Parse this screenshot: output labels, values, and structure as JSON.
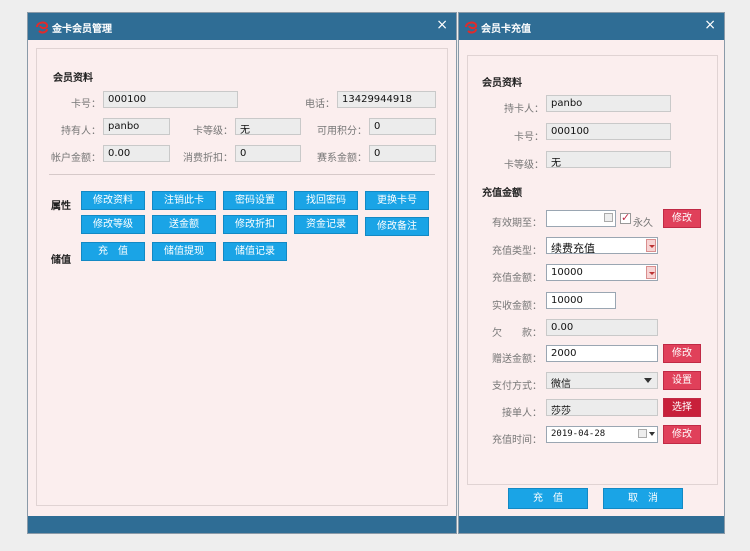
{
  "left_window": {
    "title": "金卡会员管理",
    "close": "×",
    "section_info": "会员资料",
    "fields": {
      "card_no": {
        "label": "卡号：",
        "value": "000100"
      },
      "phone": {
        "label": "电话：",
        "value": "13429944918"
      },
      "holder": {
        "label": "持有人：",
        "value": "panbo"
      },
      "card_level": {
        "label": "卡等级：",
        "value": "无"
      },
      "points": {
        "label": "可用积分：",
        "value": "0"
      },
      "balance": {
        "label": "帐户金额：",
        "value": "0.00"
      },
      "discount": {
        "label": "消费折扣：",
        "value": "0"
      },
      "gift_amount": {
        "label": "赛系金额：",
        "value": "0"
      }
    },
    "attr_label": "属性",
    "store_label": "储值",
    "attr_buttons_row1": [
      "修改资料",
      "注销此卡",
      "密码设置",
      "找回密码",
      "更换卡号"
    ],
    "attr_buttons_row2": [
      "修改等级",
      "送金额",
      "修改折扣",
      "资金记录",
      "修改备注"
    ],
    "store_buttons": [
      "充　值",
      "储值提现",
      "储值记录"
    ]
  },
  "right_window": {
    "title": "会员卡充值",
    "close": "×",
    "section_info": "会员资料",
    "holder": {
      "label": "持卡人：",
      "value": "panbo"
    },
    "card_no": {
      "label": "卡号：",
      "value": "000100"
    },
    "card_level": {
      "label": "卡等级：",
      "value": "无"
    },
    "section_recharge": "充值金额",
    "valid_until": {
      "label": "有效期至：",
      "value": "",
      "forever_label": "永久",
      "forever_checked": true,
      "button": "修改"
    },
    "recharge_type": {
      "label": "充值类型：",
      "value": "续费充值"
    },
    "recharge_amount": {
      "label": "充值金额：",
      "value": "10000"
    },
    "actual_amount": {
      "label": "实收金额：",
      "value": "10000"
    },
    "owed": {
      "label": "欠　　款：",
      "value": "0.00"
    },
    "bonus_amount": {
      "label": "赠送金额：",
      "value": "2000",
      "button": "修改"
    },
    "pay_method": {
      "label": "支付方式：",
      "value": "微信",
      "button": "设置"
    },
    "handler": {
      "label": "接单人：",
      "value": "莎莎",
      "button": "选择"
    },
    "recharge_time": {
      "label": "充值时间：",
      "value": "2019-04-28",
      "button": "修改"
    },
    "confirm_button": "充　值",
    "cancel_button": "取　消"
  }
}
